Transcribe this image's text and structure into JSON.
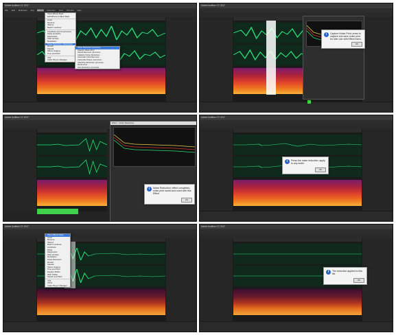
{
  "app": {
    "title": "Adobe Audition CC 2017",
    "menus": [
      "File",
      "Edit",
      "Multitrack",
      "Clip",
      "Effects",
      "Favorites",
      "View",
      "Window",
      "Help"
    ]
  },
  "panels": [
    {
      "id": "p1",
      "menu_items": [
        "Show Effects Rack",
        "Edit Effects in Effect Rack",
        "Invert",
        "Reverse",
        "Silence",
        "Match Loudness",
        "Amplitude and Compression",
        "Delay and Echo",
        "Diagnostics",
        "Filter and EQ",
        "Modulation",
        "Noise Reduction / Restoration",
        "Reverb",
        "Special",
        "Stereo Imagery",
        "Time and Pitch",
        "VST",
        "Audio Plug-In Manager..."
      ],
      "highlighted": "Noise Reduction / Restoration",
      "submenu_items": [
        "Noise Reduction (process)...",
        "Capture Noise Print",
        "Sound Remover (process)...",
        "Adaptive Noise Reduction...",
        "Automatic Click Remover...",
        "Automatic Phase Correction...",
        "Click/Pop Eliminator (process)...",
        "DeHummer...",
        "Hiss Reduction (process)..."
      ],
      "submenu_highlighted": "Noise Reduction (process)..."
    },
    {
      "id": "p2",
      "dialog": {
        "title": "Capture Noise Print",
        "text": "Capture Noise Print: press to capture and save noise print for later use with Effect menu",
        "ok": "OK"
      }
    },
    {
      "id": "p3",
      "effect_title": "Effect - Noise Reduction",
      "dialog": {
        "text": "Noise Reduction: effect completes; noise print saved and used with this Effect",
        "ok": "OK"
      }
    },
    {
      "id": "p4",
      "dialog": {
        "text": "Press the noise reduction; apply to any audio",
        "ok": "OK"
      }
    },
    {
      "id": "p5",
      "menu_items": [
        "Show Effects Rack",
        "Invert",
        "Reverse",
        "Silence",
        "Match Loudness",
        "Amplitude",
        "Delay",
        "Diagnostics",
        "Filter and EQ",
        "Modulation",
        "Noise Reduction",
        "Reverb",
        "Special",
        "Stereo Imagery",
        "Time and Pitch",
        "Doppler Shifter",
        "Pitch Shifter",
        "Stretch and Pitch",
        "VST",
        "VST3",
        "Audio Plug-In Manager..."
      ],
      "highlighted": "Show Effects Rack"
    },
    {
      "id": "p6",
      "dialog": {
        "text": "The reduction applied to this file",
        "ok": "OK"
      }
    }
  ],
  "colors": {
    "bg": "#232323",
    "waveform": "#2ee07a",
    "highlight": "#3a7ad8",
    "info": "#2a63c7"
  }
}
